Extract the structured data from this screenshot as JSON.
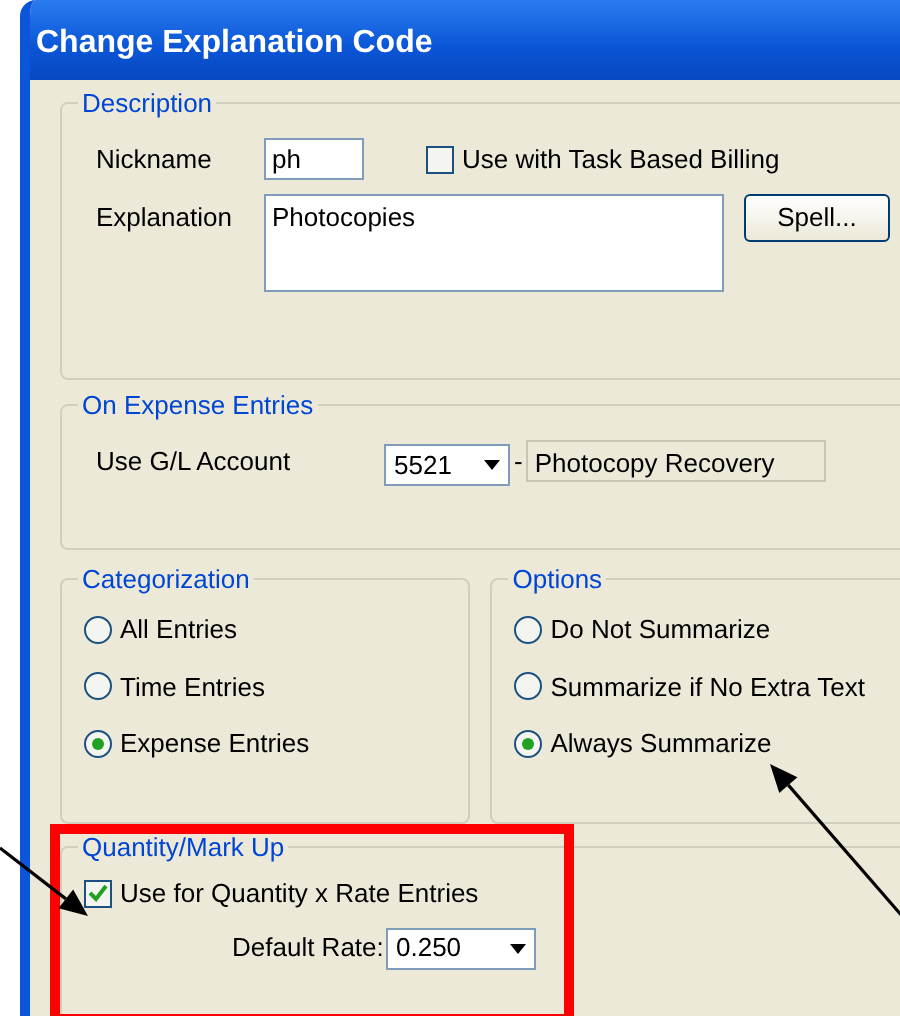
{
  "window": {
    "title": "Change Explanation Code"
  },
  "description": {
    "legend": "Description",
    "nickname_label": "Nickname",
    "nickname": "ph",
    "task_based_billing": {
      "label": "Use with Task Based Billing",
      "checked": false
    },
    "explanation_label": "Explanation",
    "explanation": "Photocopies",
    "spell_button": "Spell..."
  },
  "expense_entries": {
    "legend": "On Expense Entries",
    "account_label": "Use G/L Account",
    "account": "5521",
    "dash": "-",
    "account_name": "Photocopy Recovery"
  },
  "categorization": {
    "legend": "Categorization",
    "choices": [
      {
        "label": "All Entries",
        "selected": false
      },
      {
        "label": "Time Entries",
        "selected": false
      },
      {
        "label": "Expense Entries",
        "selected": true
      }
    ]
  },
  "options": {
    "legend": "Options",
    "choices": [
      {
        "label": "Do Not Summarize",
        "selected": false
      },
      {
        "label": "Summarize if No Extra Text",
        "selected": false
      },
      {
        "label": "Always Summarize",
        "selected": true
      }
    ]
  },
  "quantity": {
    "legend": "Quantity/Mark Up",
    "use_for_quantity": {
      "label": "Use for Quantity x Rate Entries",
      "checked": true
    },
    "rate_label": "Default Rate:",
    "rate": "0.250"
  },
  "annotations": [
    {
      "kind": "highlight"
    },
    {
      "kind": "arrow"
    },
    {
      "kind": "arrow"
    }
  ]
}
